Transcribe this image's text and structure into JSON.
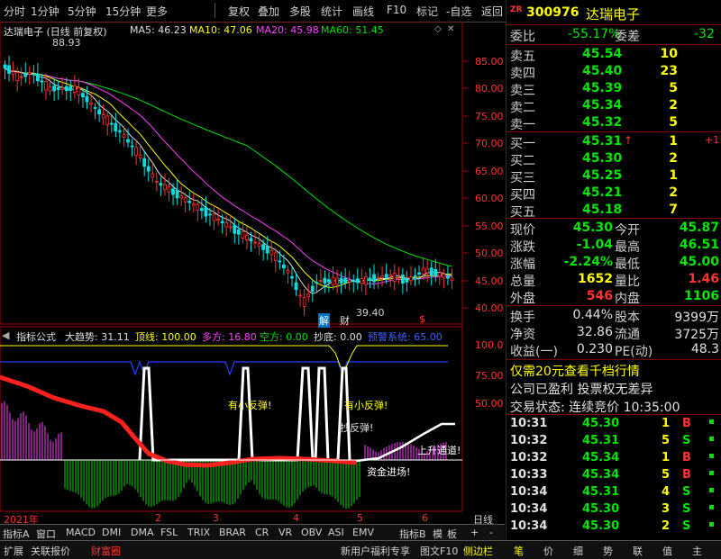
{
  "toolbar": {
    "items": [
      "分时",
      "1分钟",
      "5分钟",
      "15分钟",
      "更多",
      "复权",
      "叠加",
      "多股",
      "统计",
      "画线",
      "F10",
      "标记",
      "-自选",
      "返回"
    ]
  },
  "chart": {
    "title": "达瑞电子 (日线 前复权)",
    "ma": [
      {
        "label": "MA5: 46.23",
        "color": "#e0e0e0"
      },
      {
        "label": "MA10: 47.06",
        "color": "#ffff00"
      },
      {
        "label": "MA20: 45.98",
        "color": "#ff40ff"
      },
      {
        "label": "MA60: 51.45",
        "color": "#00e000"
      }
    ],
    "y_ticks": [
      "85.00",
      "80.00",
      "75.00",
      "70.00",
      "65.00",
      "60.00",
      "55.00",
      "50.00",
      "45.00",
      "40.00"
    ],
    "high_label": "88.93",
    "low_label": "39.40",
    "event_markers": [
      "解",
      "财",
      "$"
    ],
    "x_ticks": [
      "2021年",
      "2",
      "3",
      "4",
      "5",
      "6"
    ],
    "x_axis_mode": "日线"
  },
  "indicator": {
    "name": "指标公式",
    "params": [
      {
        "label": "大趋势: 31.11",
        "color": "#e0e0e0"
      },
      {
        "label": "顶线: 100.00",
        "color": "#ffff00"
      },
      {
        "label": "多方: 16.80",
        "color": "#ff40ff"
      },
      {
        "label": "空方: 0.00",
        "color": "#00e000"
      },
      {
        "label": "抄底: 0.00",
        "color": "#e0e0e0"
      },
      {
        "label": "预警系统: 65.00",
        "color": "#4060ff"
      }
    ],
    "y_ticks": [
      "100.0",
      "75.00",
      "50.00"
    ],
    "annotations": [
      "有小反弹!",
      "有小反弹!",
      "抄反弹!",
      "上升通道!",
      "资金进场!"
    ]
  },
  "bottom_tabs": [
    "指标A",
    "窗口",
    "MACD",
    "DMI",
    "DMA",
    "FSL",
    "TRIX",
    "BRAR",
    "CR",
    "VR",
    "OBV",
    "ASI",
    "EMV",
    "指标B",
    "模",
    "板",
    "+",
    "-"
  ],
  "footer": {
    "left": [
      "扩展",
      "关联报价",
      "财富圈"
    ],
    "right": [
      "新用户福利专享",
      "图文F10",
      "侧边栏"
    ],
    "side_tabs": [
      "笔",
      "价",
      "细",
      "势",
      "联",
      "值",
      "主"
    ]
  },
  "stock": {
    "badge": "ZR",
    "code": "300976",
    "name": "达瑞电子",
    "weibi_label": "委比",
    "weibi": "-55.17%",
    "weicha_label": "委差",
    "weicha": "-32",
    "asks": [
      {
        "label": "卖五",
        "price": "45.54",
        "vol": "10"
      },
      {
        "label": "卖四",
        "price": "45.40",
        "vol": "23"
      },
      {
        "label": "卖三",
        "price": "45.39",
        "vol": "5"
      },
      {
        "label": "卖二",
        "price": "45.34",
        "vol": "2"
      },
      {
        "label": "卖一",
        "price": "45.32",
        "vol": "5"
      }
    ],
    "bids": [
      {
        "label": "买一",
        "price": "45.31",
        "vol": "1",
        "chg": "+1"
      },
      {
        "label": "买二",
        "price": "45.30",
        "vol": "2",
        "chg": ""
      },
      {
        "label": "买三",
        "price": "45.25",
        "vol": "1",
        "chg": ""
      },
      {
        "label": "买四",
        "price": "45.21",
        "vol": "2",
        "chg": ""
      },
      {
        "label": "买五",
        "price": "45.18",
        "vol": "7",
        "chg": ""
      }
    ],
    "quote": [
      {
        "l1": "现价",
        "v1": "45.30",
        "c1": "#00e600",
        "l2": "今开",
        "v2": "45.87",
        "c2": "#00e600"
      },
      {
        "l1": "涨跌",
        "v1": "-1.04",
        "c1": "#00e600",
        "l2": "最高",
        "v2": "46.51",
        "c2": "#00e600"
      },
      {
        "l1": "涨幅",
        "v1": "-2.24%",
        "c1": "#00e600",
        "l2": "最低",
        "v2": "45.00",
        "c2": "#00e600"
      },
      {
        "l1": "总量",
        "v1": "1652",
        "c1": "#ffff00",
        "l2": "量比",
        "v2": "1.46",
        "c2": "#ff3232"
      },
      {
        "l1": "外盘",
        "v1": "546",
        "c1": "#ff3232",
        "l2": "内盘",
        "v2": "1106",
        "c2": "#00e600"
      }
    ],
    "stats": [
      {
        "l1": "换手",
        "v1": "0.44%",
        "l2": "股本",
        "v2": "9399万"
      },
      {
        "l1": "净资",
        "v1": "32.86",
        "l2": "流通",
        "v2": "3725万"
      },
      {
        "l1": "收益(一)",
        "v1": "0.230",
        "l2": "PE(动)",
        "v2": "48.3"
      }
    ],
    "promo1": "仅需20元查看千档行情",
    "promo2": "公司已盈利 投票权无差异",
    "trade_status": "交易状态: 连续竞价 10:35:00",
    "ticks": [
      {
        "time": "10:31",
        "price": "45.30",
        "vol": "1",
        "bs": "B",
        "c": "#ff3232"
      },
      {
        "time": "10:32",
        "price": "45.31",
        "vol": "5",
        "bs": "S",
        "c": "#00e600"
      },
      {
        "time": "10:32",
        "price": "45.34",
        "vol": "1",
        "bs": "B",
        "c": "#ff3232"
      },
      {
        "time": "10:33",
        "price": "45.34",
        "vol": "5",
        "bs": "B",
        "c": "#ff3232"
      },
      {
        "time": "10:34",
        "price": "45.31",
        "vol": "4",
        "bs": "S",
        "c": "#00e600"
      },
      {
        "time": "10:34",
        "price": "45.30",
        "vol": "3",
        "bs": "S",
        "c": "#00e600"
      },
      {
        "time": "10:34",
        "price": "45.30",
        "vol": "2",
        "bs": "S",
        "c": "#00e600"
      }
    ]
  }
}
